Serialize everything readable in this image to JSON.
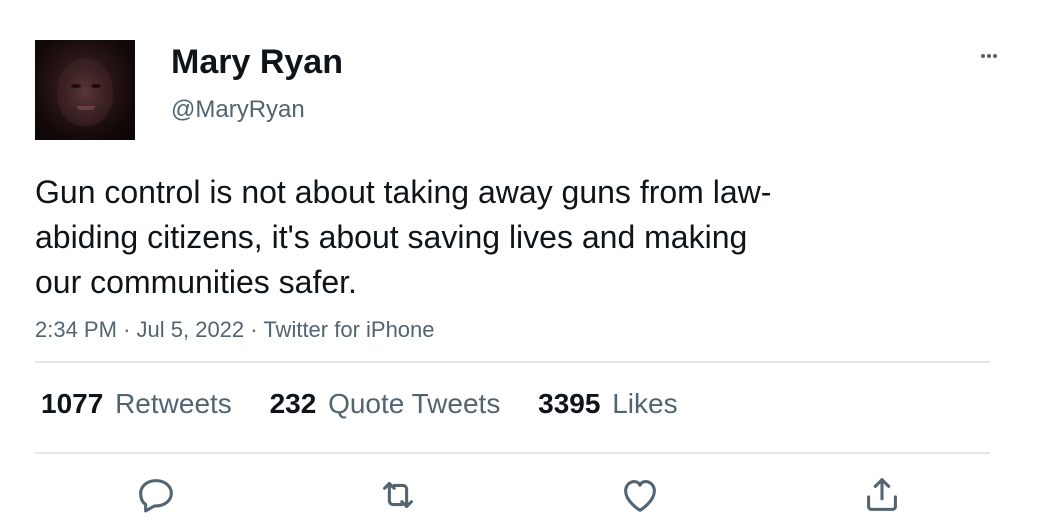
{
  "author": {
    "name": "Mary Ryan",
    "handle": "@MaryRyan"
  },
  "tweet": {
    "text": "Gun control is not about taking away guns from law-\nabiding citizens, it's about saving lives and making\nour communities safer.",
    "time": "2:34 PM",
    "date": "Jul 5, 2022",
    "source": "Twitter for iPhone",
    "separator": "·"
  },
  "stats": {
    "retweets": {
      "count": "1077",
      "label": "Retweets"
    },
    "quotes": {
      "count": "232",
      "label": "Quote Tweets"
    },
    "likes": {
      "count": "3395",
      "label": "Likes"
    }
  },
  "icons": {
    "more": "more-options-icon",
    "reply": "reply-icon",
    "retweet": "retweet-icon",
    "like": "like-icon",
    "share": "share-icon"
  },
  "colors": {
    "text_primary": "#0f1419",
    "text_secondary": "#536471",
    "divider": "#e6e6e6",
    "background": "#ffffff"
  }
}
